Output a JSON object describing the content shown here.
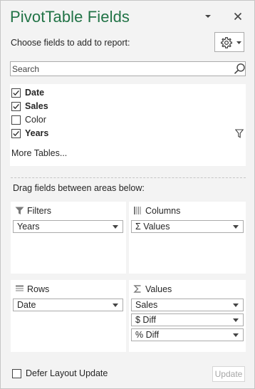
{
  "title": "PivotTable Fields",
  "choose_label": "Choose fields to add to report:",
  "search": {
    "placeholder": "Search",
    "value": ""
  },
  "fields": [
    {
      "label": "Date",
      "checked": true
    },
    {
      "label": "Sales",
      "checked": true
    },
    {
      "label": "Color",
      "checked": false
    },
    {
      "label": "Years",
      "checked": true
    }
  ],
  "more_tables": "More Tables...",
  "drag_label": "Drag fields between areas below:",
  "areas": {
    "filters": {
      "label": "Filters",
      "icon": "filter-icon",
      "items": [
        "Years"
      ]
    },
    "columns": {
      "label": "Columns",
      "icon": "columns-icon",
      "items": [
        "Σ Values"
      ]
    },
    "rows": {
      "label": "Rows",
      "icon": "rows-icon",
      "items": [
        "Date"
      ]
    },
    "values": {
      "label": "Values",
      "icon": "sigma-icon",
      "items": [
        "Sales",
        "$ Diff",
        "% Diff"
      ]
    }
  },
  "defer_label": "Defer Layout Update",
  "update_label": "Update",
  "colors": {
    "title": "#217346",
    "pane_bg": "#f3f3f3",
    "disabled_text": "#a6a6a6"
  }
}
